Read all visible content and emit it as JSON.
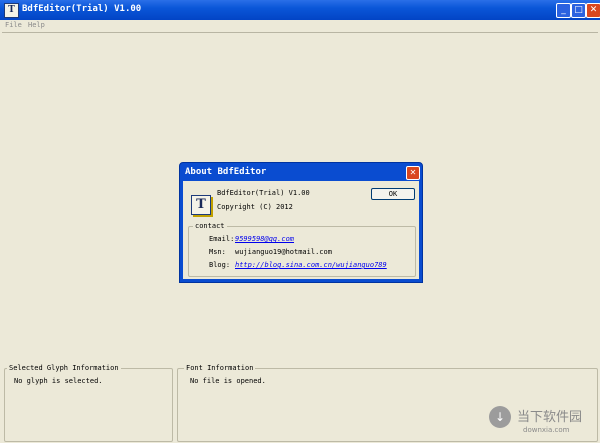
{
  "window": {
    "title": "BdfEditor(Trial) V1.00",
    "icon_letter": "T",
    "minimize_glyph": "_",
    "maximize_glyph": "□",
    "close_glyph": "✕"
  },
  "menubar": {
    "items": [
      "File",
      "Help"
    ]
  },
  "about_dialog": {
    "title": "About BdfEditor",
    "close_glyph": "✕",
    "icon_letter": "T",
    "product": "BdfEditor(Trial) V1.00",
    "copyright": "Copyright (C) 2012",
    "ok_label": "OK",
    "contact": {
      "group_label": "contact",
      "email_label": "Email:",
      "email_value": "9599598@qq.com",
      "msn_label": "Msn:",
      "msn_value": "wujianguo19@hotmail.com",
      "blog_label": "Blog:",
      "blog_value": "http://blog.sina.com.cn/wujianguo789"
    }
  },
  "panels": {
    "glyph_info": {
      "label": "Selected Glyph Information",
      "text": "No glyph is selected."
    },
    "font_info": {
      "label": "Font Information",
      "text": "No file is opened."
    }
  },
  "watermark": {
    "glyph": "↓",
    "text": "当下软件园",
    "url": "downxia.com"
  },
  "colors": {
    "titlebar": "#0a56d8",
    "window_bg": "#ece9d8",
    "close_red": "#d9471f",
    "link": "#0000ee"
  }
}
